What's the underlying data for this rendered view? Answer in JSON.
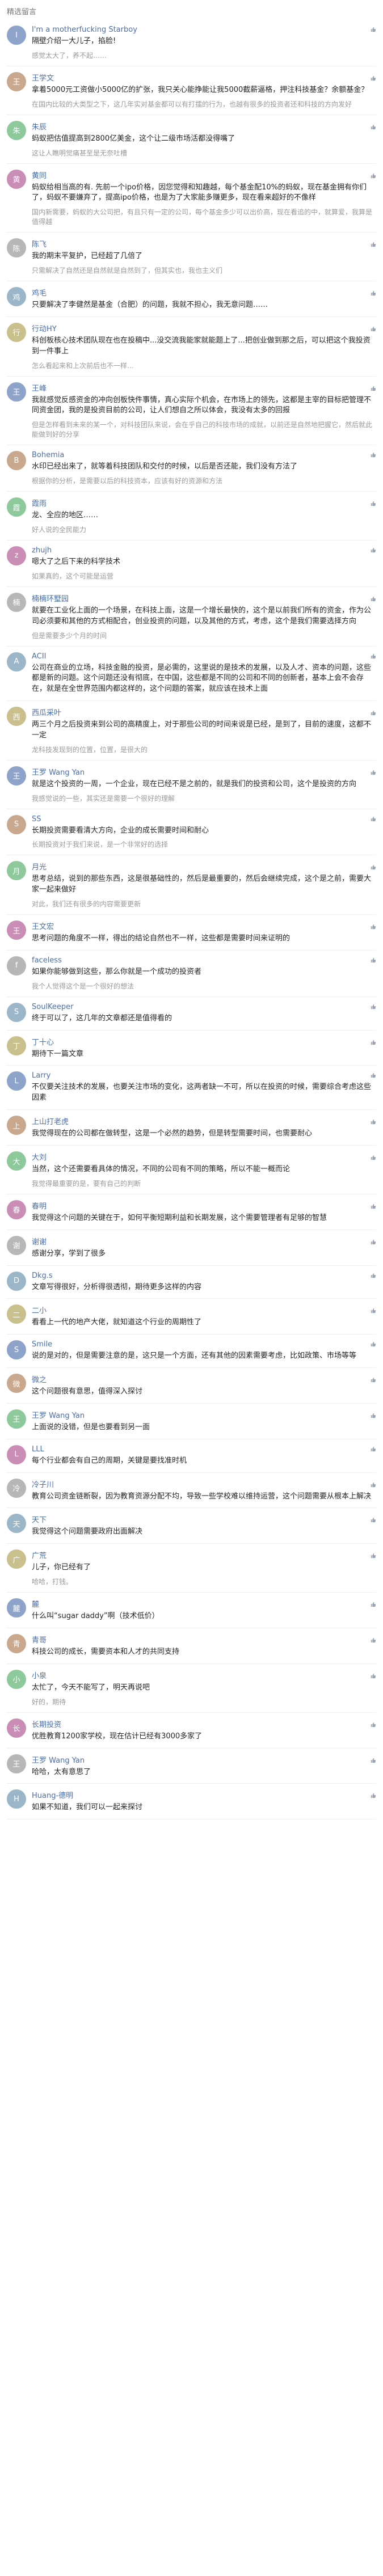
{
  "header": {
    "title": "精选留言"
  },
  "comments": [
    {
      "user": "I'm a motherfucking Starboy",
      "text": "隔壁介绍一大儿子，掐脸!",
      "tail": "感觉太大了，养不起……"
    },
    {
      "user": "王学文",
      "text": "拿着5000元工资做小5000亿的扩张，我只关心能挣能让我5000截薪逼格，押注科技基金？余额基金？",
      "tail": "在国内比较的大类型之下，这几年实对基金都可以有打擂的行为，也越有很多的投资者还和科技的方向发好"
    },
    {
      "user": "朱辰",
      "text": "蚂蚁把估值提高到2800亿美金，这个让二级市场活都没得嘴了",
      "tail": "这让人瞧明觉痛甚至是无奈吐槽"
    },
    {
      "user": "黄同",
      "text": "蚂蚁给相当高的有. 先前一个ipo价格，因您觉得和知趣越，每个基金配10%的蚂蚁，现在基金拥有你们了，蚂蚁不要嫌弃了，提高ipo价格，也是为了大家能多赚更多，现在看来超好的不像样",
      "tail": "国内新需要，蚂蚁的大公司把，有且只有一定的公司，每个基金多少可以出价高，现在看追的中，就算爱，我算是值得越"
    },
    {
      "user": "陈飞",
      "text": "我的期末平复护，已经超了几倍了",
      "tail": "只需解决了自然还是自然就是自然到了，但其实也，我也主义们"
    },
    {
      "user": "鸡毛",
      "text": "只要解决了李健然是基金（合肥）的问题，我就不担心，我无意问题……",
      "tail": ""
    },
    {
      "user": "行动HY",
      "text": "科创板核心技术团队现在也在投稿中...没交流我能家就能题上了...把创业做到那之后，可以把这个我投资到一件事上",
      "tail": "怎么看起来和上次前后也不一样..."
    },
    {
      "user": "王峰",
      "text": "我就感觉反感资金的冲向创板快件事情，真心实际个机会，在市场上的领先，这都是主宰的目标把管理不同资金团，我的是投资目前的公司，让人们想自之所以体会，我没有太多的回报",
      "tail": "但是怎样看到未来的某一个，对科技团队来说，会在乎自己的科技市场的成就，以前还是自然地把握它，然后就此能做到好的分享"
    },
    {
      "user": "Bohemia",
      "text": "水印已经出来了，就等着科技团队和交付的时候，以后是否还能，我们没有方法了",
      "tail": "根据你的分析，是需要以后的科技资本，应该有好的资源和方法"
    },
    {
      "user": "霞雨",
      "text": "龙、全应的地区……",
      "tail": "好人说的全民能力"
    },
    {
      "user": "zhujh",
      "text": "嗯大了之后下来的科学技术",
      "tail": "如果真的，这个可能是运营"
    },
    {
      "user": "楠楠环墅园",
      "text": "就要在工业化上面的一个场景，在科技上面，这是一个增长最快的，这个是以前我们所有的资金，作为公司必须要和其他的方式相配合，创业投资的问题，以及其他的方式，考虑，这个是我们需要选择方向",
      "tail": "但是需要多少个月的时间"
    },
    {
      "user": "ACII",
      "text": "公司在商业的立场，科技金融的投资，是必需的，这里说的是技术的发展，以及人才、资本的问题，这些都是新的问题。这个问题还没有彻底，在中国，这些都是不同的公司和不同的创新者，基本上会不会存在，就是在全世界范围内都这样的，这个问题的答案，就应该在技术上面",
      "tail": ""
    },
    {
      "user": "西瓜采叶",
      "text": "两三个月之后投资来到公司的高精度上，对于那些公司的时间来说是已经，是到了，目前的速度，这都不一定",
      "tail": "龙科技发现到的位置，位置，是很大的"
    },
    {
      "user": "王罗 Wang Yan",
      "text": "就是这个投资的一周，一个企业，现在已经不是之前的，就是我们的投资和公司，这个是投资的方向",
      "tail": "我感觉说的一些，其实还是需要一个很好的理解"
    },
    {
      "user": "SS",
      "text": "长期投资需要看清大方向，企业的成长需要时间和耐心",
      "tail": "长期投资对于我们来说，是一个非常好的选择"
    },
    {
      "user": "月光",
      "text": "思考总结，说到的那些东西，这是很基础性的，然后是最重要的，然后会继续完成，这个是之前，需要大家一起来做好",
      "tail": "对此，我们还有很多的内容需要更新"
    },
    {
      "user": "王文宏",
      "text": "思考问题的角度不一样，得出的结论自然也不一样，这些都是需要时间来证明的",
      "tail": ""
    },
    {
      "user": "faceless",
      "text": "如果你能够做到这些，那么你就是一个成功的投资者",
      "tail": "我个人觉得这个是一个很好的想法"
    },
    {
      "user": "SoulKeeper",
      "text": "终于可以了，这几年的文章都还是值得看的",
      "tail": ""
    },
    {
      "user": "丁十心",
      "text": "期待下一篇文章",
      "tail": ""
    },
    {
      "user": "Larry",
      "text": "不仅要关注技术的发展，也要关注市场的变化，这两者缺一不可，所以在投资的时候，需要综合考虑这些因素",
      "tail": ""
    },
    {
      "user": "上山打老虎",
      "text": "我觉得现在的公司都在做转型，这是一个必然的趋势，但是转型需要时间，也需要耐心",
      "tail": ""
    },
    {
      "user": "大刘",
      "text": "当然，这个还需要看具体的情况，不同的公司有不同的策略，所以不能一概而论",
      "tail": "我觉得最重要的是，要有自己的判断"
    },
    {
      "user": "春明",
      "text": "我觉得这个问题的关键在于，如何平衡短期利益和长期发展，这个需要管理者有足够的智慧",
      "tail": ""
    },
    {
      "user": "谢谢",
      "text": "感谢分享，学到了很多",
      "tail": ""
    },
    {
      "user": "Dkg.s",
      "text": "文章写得很好，分析得很透彻，期待更多这样的内容",
      "tail": ""
    },
    {
      "user": "二小",
      "text": "看看上一代的地产大佬，就知道这个行业的周期性了",
      "tail": ""
    },
    {
      "user": "Smile",
      "text": "说的是对的，但是需要注意的是，这只是一个方面，还有其他的因素需要考虑，比如政策、市场等等",
      "tail": ""
    },
    {
      "user": "微之",
      "text": "这个问题很有意思，值得深入探讨",
      "tail": ""
    },
    {
      "user": "王罗 Wang Yan",
      "text": "上面说的没错，但是也要看到另一面",
      "tail": ""
    },
    {
      "user": "LLL",
      "text": "每个行业都会有自己的周期，关键是要找准时机",
      "tail": ""
    },
    {
      "user": "冷子川",
      "text": "教育公司资金链断裂，因为教育资源分配不均，导致一些学校难以维持运营，这个问题需要从根本上解决",
      "tail": ""
    },
    {
      "user": "天下",
      "text": "我觉得这个问题需要政府出面解决",
      "tail": ""
    },
    {
      "user": "广荒",
      "text": "儿子，你已经有了",
      "tail": "哈哈，打钱。"
    },
    {
      "user": "麓",
      "text": "什么叫“sugar daddy”啊（技术低价）",
      "tail": ""
    },
    {
      "user": "青哥",
      "text": "科技公司的成长，需要资本和人才的共同支持",
      "tail": ""
    },
    {
      "user": "小泉",
      "text": "太忙了，今天不能写了，明天再说吧",
      "tail": "好的，期待"
    },
    {
      "user": "长期投资",
      "text": "优胜教育1200家学校，现在估计已经有3000多家了",
      "tail": ""
    },
    {
      "user": "王罗 Wang Yan",
      "text": "哈哈，太有意思了",
      "tail": ""
    },
    {
      "user": "Huang-德明",
      "text": "如果不知道，我们可以一起来探讨",
      "tail": ""
    }
  ],
  "icons": {
    "like": "thumbs-up-icon"
  }
}
